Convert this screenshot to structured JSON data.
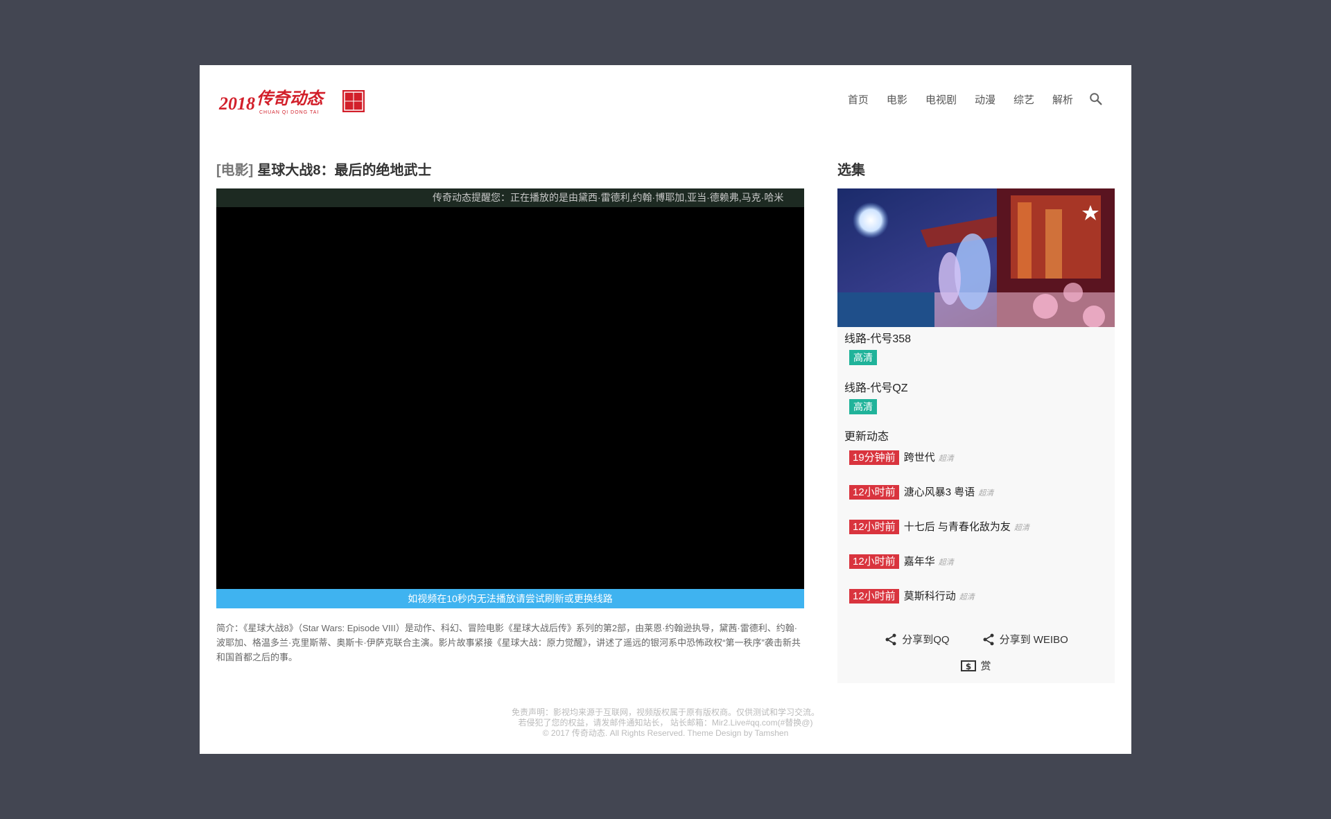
{
  "logo": {
    "year": "2018",
    "text": "传奇动态",
    "sub": "CHUAN QI DONG TAI"
  },
  "nav": {
    "items": [
      "首页",
      "电影",
      "电视剧",
      "动漫",
      "综艺",
      "解析"
    ]
  },
  "main": {
    "category": "[电影]",
    "title": "星球大战8：最后的绝地武士",
    "player_notice": "传奇动态提醒您：正在播放的是由黛西·雷德利,约翰·博耶加,亚当·德赖弗,马克·哈米",
    "player_tip": "如视频在10秒内无法播放请尝试刷新或更换线路",
    "description": "简介：《星球大战8》（Star Wars: Episode VIII）是动作、科幻、冒险电影《星球大战后传》系列的第2部，由莱恩·约翰逊执导，黛茜·雷德利、约翰·波耶加、格温多兰·克里斯蒂、奥斯卡·伊萨克联合主演。影片故事紧接《星球大战：原力觉醒》，讲述了遥远的银河系中恐怖政权“第一秩序”袭击新共和国首都之后的事。"
  },
  "sidebar": {
    "title": "选集",
    "lines": [
      {
        "name": "线路-代号358",
        "badge": "高清"
      },
      {
        "name": "线路-代号QZ",
        "badge": "高清"
      }
    ],
    "updates_title": "更新动态",
    "updates": [
      {
        "time": "19分钟前",
        "name": "跨世代",
        "quality": "超清"
      },
      {
        "time": "12小时前",
        "name": "溏心风暴3 粤语",
        "quality": "超清"
      },
      {
        "time": "12小时前",
        "name": "十七后 与青春化敌为友",
        "quality": "超清"
      },
      {
        "time": "12小时前",
        "name": "嘉年华",
        "quality": "超清"
      },
      {
        "time": "12小时前",
        "name": "莫斯科行动",
        "quality": "超清"
      }
    ],
    "share_qq": "分享到QQ",
    "share_weibo": "分享到 WEIBO",
    "reward": "赏"
  },
  "footer": {
    "line1": "免责声明：影视均来源于互联网，视频版权属于原有版权商。仅供测试和学习交流。",
    "line2": "若侵犯了您的权益，请发邮件通知站长， 站长邮箱：Mir2.Live#qq.com(#替换@)",
    "line3": "© 2017 传奇动态. All Rights Reserved. Theme Design by Tamshen"
  },
  "colors": {
    "background": "#434652",
    "hd_badge": "#20b39a",
    "time_badge": "#d9343e",
    "tip_bar": "#3fb3f0",
    "logo_red": "#d21f2a"
  }
}
